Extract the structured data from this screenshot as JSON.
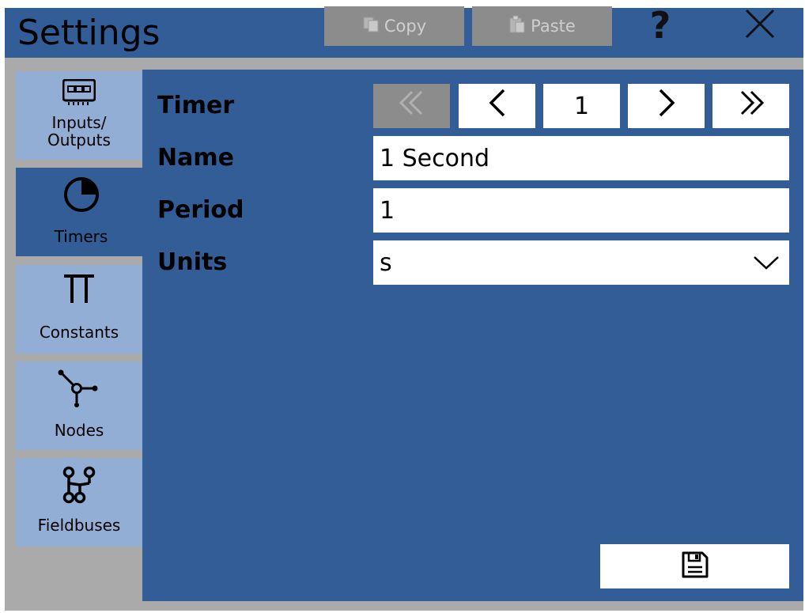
{
  "window": {
    "title": "Settings",
    "copy_label": "Copy",
    "paste_label": "Paste",
    "help_label": "?",
    "close_label": "✕"
  },
  "sidebar": {
    "items": [
      {
        "label": "Inputs/\nOutputs",
        "icon": "io-board-icon",
        "active": false
      },
      {
        "label": "Timers",
        "icon": "timer-icon",
        "active": true
      },
      {
        "label": "Constants",
        "icon": "pi-constant-icon",
        "active": false
      },
      {
        "label": "Nodes",
        "icon": "node-icon",
        "active": false
      },
      {
        "label": "Fieldbuses",
        "icon": "fieldbus-icon",
        "active": false
      }
    ]
  },
  "form": {
    "timer_label": "Timer",
    "name_label": "Name",
    "period_label": "Period",
    "units_label": "Units",
    "nav": {
      "first": "«",
      "prev": "<",
      "current": "1",
      "next": ">",
      "last": "»"
    },
    "name_value": "1 Second",
    "period_value": "1",
    "units_value": "s"
  },
  "colors": {
    "panel_blue": "#325d96",
    "sidebar_blue": "#93aed4",
    "disabled_gray": "#8c8c8c",
    "frame_gray": "#aaaaaa"
  }
}
